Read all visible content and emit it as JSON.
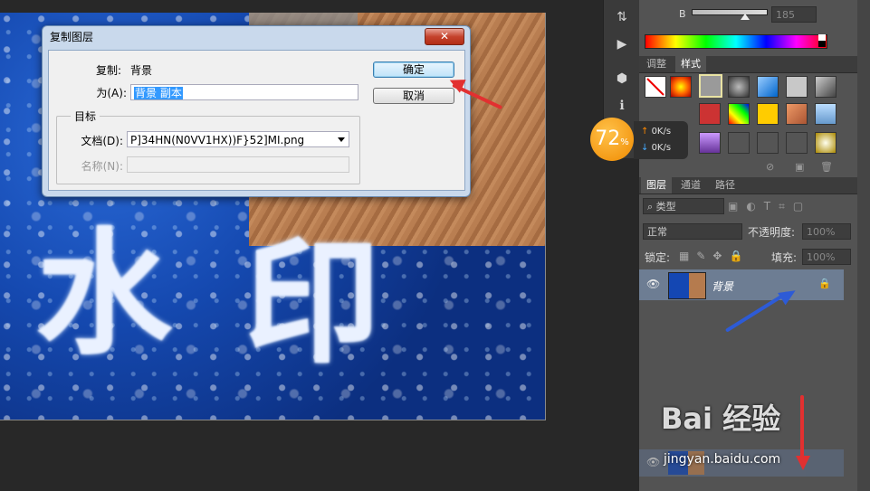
{
  "dialog": {
    "title": "复制图层",
    "close": "✕",
    "copy_label": "复制:",
    "copy_value": "背景",
    "as_label": "为(A):",
    "as_value": "背景 副本",
    "ok": "确定",
    "cancel": "取消",
    "target_group": "目标",
    "doc_label": "文档(D):",
    "doc_value": "P]34HN(N0VV1HX))F}52]MI.png",
    "name_label": "名称(N):"
  },
  "color_panel": {
    "channel": "B",
    "value": "185"
  },
  "styles_panel": {
    "tabs": [
      "调整",
      "样式"
    ]
  },
  "layers_panel": {
    "tabs": [
      "图层",
      "通道",
      "路径"
    ],
    "filter": "类型",
    "blend_mode": "正常",
    "opacity_label": "不透明度:",
    "opacity_value": "100%",
    "lock_label": "锁定:",
    "fill_label": "填充:",
    "fill_value": "100%",
    "layer_name": "背景"
  },
  "speed_widget": {
    "percent": "72",
    "percent_sign": "%",
    "up": "0K/s",
    "down": "0K/s"
  },
  "watermark": {
    "text": "Bai 经验",
    "url": "jingyan.baidu.com"
  },
  "colors": {
    "accent_red": "#e23030",
    "accent_blue": "#2d5bd6",
    "orange": "#f08a00"
  }
}
